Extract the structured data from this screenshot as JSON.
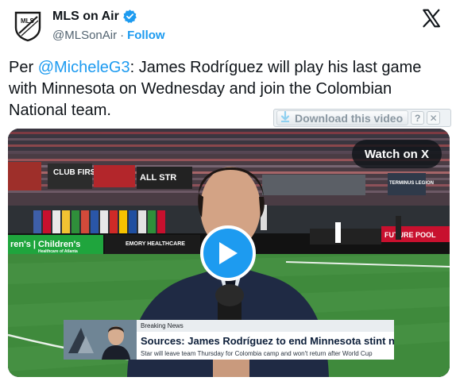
{
  "account": {
    "display_name": "MLS on Air",
    "handle": "@MLSonAir",
    "separator": "·",
    "follow_label": "Follow",
    "avatar_text": "MLS"
  },
  "icons": {
    "avatar": "mls-logo-icon",
    "verified": "verified-badge-icon",
    "x_logo": "x-logo-icon",
    "play": "play-icon",
    "download": "download-arrow-icon",
    "help": "help-icon",
    "close": "close-icon"
  },
  "tweet": {
    "prefix": "Per ",
    "mention": "@MicheleG3",
    "body": ": James Rodríguez will play his last game with Minnesota on Wednesday and join the Colombian National team."
  },
  "download_bar": {
    "label": "Download this video",
    "help": "?",
    "close": "✕"
  },
  "video": {
    "watch_label": "Watch on X",
    "lower_third": {
      "tag": "Breaking News",
      "headline": "Sources: James Rodríguez to end Minnesota stint next week",
      "subline": "Star will leave team Thursday for Colombia camp and won't return after World Cup"
    },
    "stadium_boards": {
      "club_first": "CLUB FIRST",
      "all_str": "ALL STR",
      "terminus": "TERMINUS LEGION",
      "emory": "EMORY HEALTHCARE",
      "childrens": "ren's | Children's",
      "childrens_sub": "Healthcare of Atlanta",
      "future": "FUTURE POOL"
    }
  },
  "colors": {
    "accent": "#1d9bf0",
    "text": "#0f1419",
    "muted": "#536471",
    "pitch": "#3f8a3c",
    "board_green": "#1fa53d",
    "board_red": "#c8102e"
  }
}
